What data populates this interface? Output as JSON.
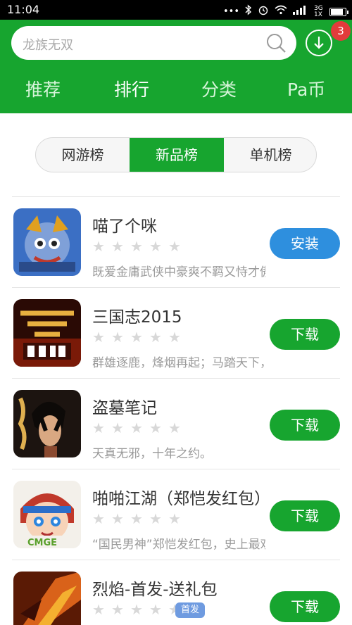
{
  "status_bar": {
    "time": "11:04",
    "network": "3G 1X",
    "icons": [
      "dots-icon",
      "bluetooth-icon",
      "alarm-icon",
      "wifi-icon",
      "signal-icon",
      "battery-icon"
    ]
  },
  "header": {
    "search_placeholder": "龙族无双",
    "download_badge": "3",
    "tabs": [
      "推荐",
      "排行",
      "分类",
      "Pa币"
    ],
    "active_tab": "排行"
  },
  "ranking_tabs": [
    "网游榜",
    "新品榜",
    "单机榜"
  ],
  "active_ranking_tab": "新品榜",
  "apps": [
    {
      "name": "喵了个咪",
      "rating": 0,
      "description": "既爱金庸武侠中豪爽不羁又恃才傲物的...",
      "button": "安装",
      "button_color": "#2e8fde",
      "tag": ""
    },
    {
      "name": "三国志2015",
      "rating": 0,
      "description": "群雄逐鹿，烽烟再起；马踏天下，由你...",
      "button": "下载",
      "button_color": "#17a52f",
      "tag": ""
    },
    {
      "name": "盗墓笔记",
      "rating": 0,
      "description": "天真无邪，十年之约。",
      "button": "下载",
      "button_color": "#17a52f",
      "tag": ""
    },
    {
      "name": "啪啪江湖（郑恺发红包）",
      "rating": 0,
      "description": "“国民男神”郑恺发红包，史上最欢乐武...",
      "button": "下载",
      "button_color": "#17a52f",
      "tag": ""
    },
    {
      "name": "烈焰-首发-送礼包",
      "rating": 0,
      "description": "",
      "button": "下载",
      "button_color": "#17a52f",
      "tag": "首发"
    }
  ],
  "icon_art": [
    "CMGE"
  ],
  "colors": {
    "brand_green": "#17a52f",
    "install_blue": "#2e8fde",
    "badge_red": "#e23b3b"
  }
}
